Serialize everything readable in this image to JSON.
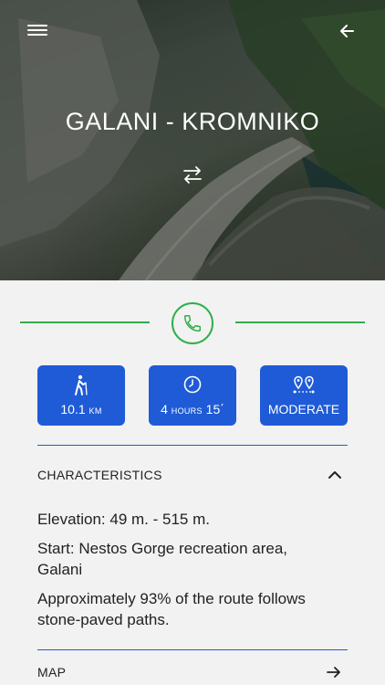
{
  "header": {
    "title": "GALANI - KROMNIKO"
  },
  "icons": {
    "menu": "menu-icon",
    "back": "arrow-left-icon",
    "swap": "swap-direction-icon",
    "phone": "phone-icon",
    "hiker": "hiker-icon",
    "clock": "clock-icon",
    "route": "route-pins-icon",
    "collapse": "chevron-up-icon",
    "open_map": "arrow-right-icon"
  },
  "stats": {
    "distance": {
      "value": "10.1",
      "unit": "KM"
    },
    "duration": {
      "hours": "4",
      "hours_unit": "HOURS",
      "minutes": "15",
      "minutes_mark": "΄"
    },
    "difficulty": {
      "label": "MODERATE"
    }
  },
  "characteristics": {
    "heading": "CHARACTERISTICS",
    "elevation": "Elevation: 49 m. - 515 m.",
    "start": "Start: Nestos Gorge recreation area, Galani",
    "surface": "Approximately 93% of the route follows stone-paved paths."
  },
  "map": {
    "heading": "MAP"
  },
  "colors": {
    "accent_blue": "#1f5bd6",
    "accent_green": "#2fae4b",
    "background": "#f2f2f2"
  }
}
